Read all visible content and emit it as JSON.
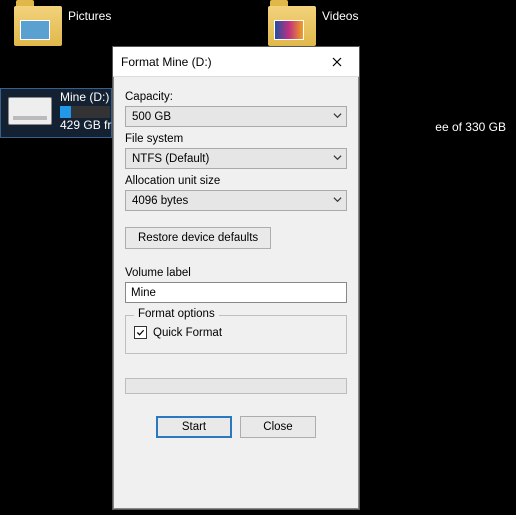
{
  "explorer": {
    "folders": [
      {
        "label": "Pictures"
      },
      {
        "label": "Videos"
      }
    ],
    "drive": {
      "name": "Mine (D:)",
      "subline": "429 GB fr",
      "free_right": "ee of 330 GB"
    }
  },
  "dialog": {
    "title": "Format Mine (D:)",
    "capacity_label": "Capacity:",
    "capacity_value": "500 GB",
    "filesystem_label": "File system",
    "filesystem_value": "NTFS (Default)",
    "alloc_label": "Allocation unit size",
    "alloc_value": "4096 bytes",
    "restore_button": "Restore device defaults",
    "volume_label": "Volume label",
    "volume_value": "Mine",
    "format_options_legend": "Format options",
    "quick_format_label": "Quick Format",
    "quick_format_checked": true,
    "start_button": "Start",
    "close_button": "Close"
  }
}
